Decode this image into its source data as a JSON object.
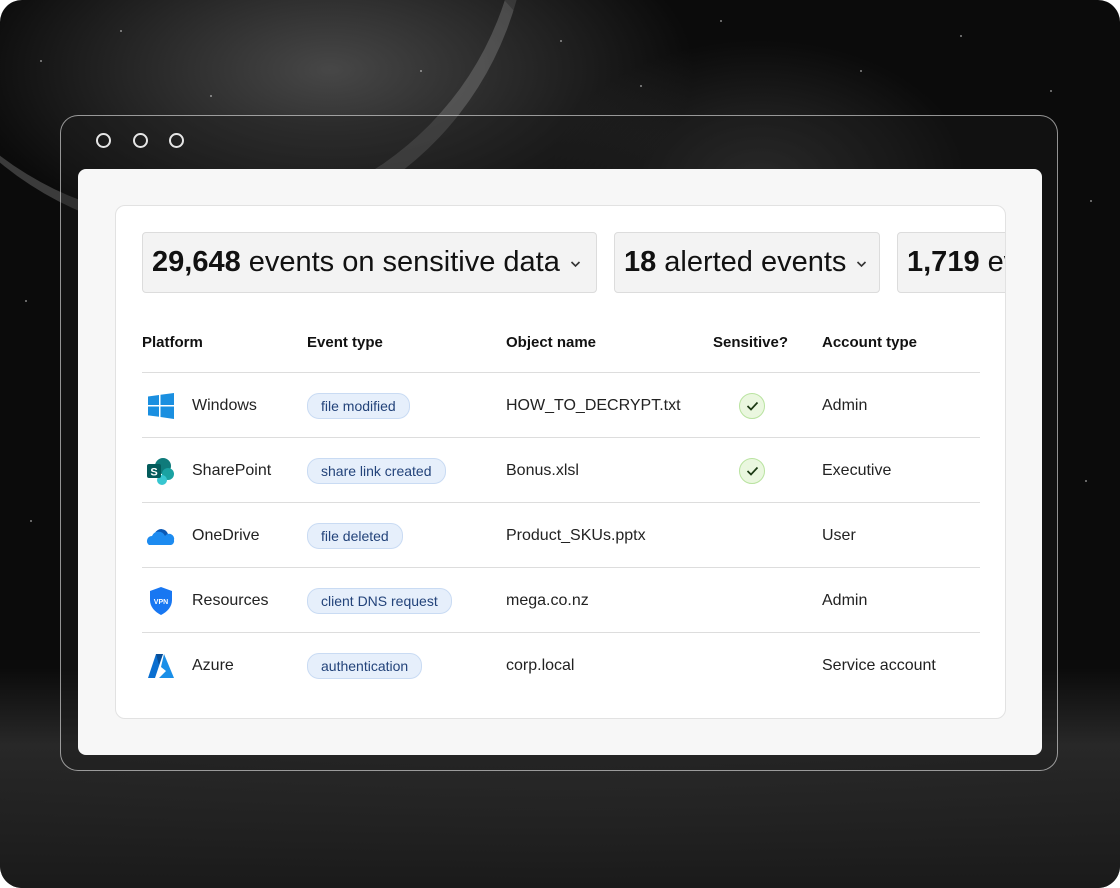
{
  "stats": [
    {
      "value": "29,648",
      "label": "events on sensitive data",
      "chevron": "chevron-down-icon"
    },
    {
      "value": "18",
      "label": "alerted events",
      "chevron": "chevron-down-icon"
    },
    {
      "value": "1,719",
      "label": "ev"
    }
  ],
  "table": {
    "headers": [
      "Platform",
      "Event type",
      "Object name",
      "Sensitive?",
      "Account type"
    ],
    "rows": [
      {
        "platform": "Windows",
        "icon": "windows-icon",
        "event": "file modified",
        "object": "HOW_TO_DECRYPT.txt",
        "sensitive": true,
        "account": "Admin"
      },
      {
        "platform": "SharePoint",
        "icon": "sharepoint-icon",
        "event": "share link created",
        "object": "Bonus.xlsl",
        "sensitive": true,
        "account": "Executive"
      },
      {
        "platform": "OneDrive",
        "icon": "onedrive-icon",
        "event": "file deleted",
        "object": "Product_SKUs.pptx",
        "sensitive": false,
        "account": "User"
      },
      {
        "platform": "Resources",
        "icon": "vpn-shield-icon",
        "event": "client DNS request",
        "object": "mega.co.nz",
        "sensitive": false,
        "account": "Admin"
      },
      {
        "platform": "Azure",
        "icon": "azure-icon",
        "event": "authentication",
        "object": "corp.local",
        "sensitive": false,
        "account": "Service account"
      }
    ]
  },
  "icon_labels": {
    "vpn": "VPN",
    "sharepoint": "S"
  },
  "colors": {
    "windows": "#1a8fe0",
    "sharepoint": "#0f7b7b",
    "onedrive": "#1976d2",
    "vpn": "#1877f2",
    "azure": "#0a6fd0",
    "badge_bg": "#e6effb",
    "check_green": "#eaf7df"
  }
}
